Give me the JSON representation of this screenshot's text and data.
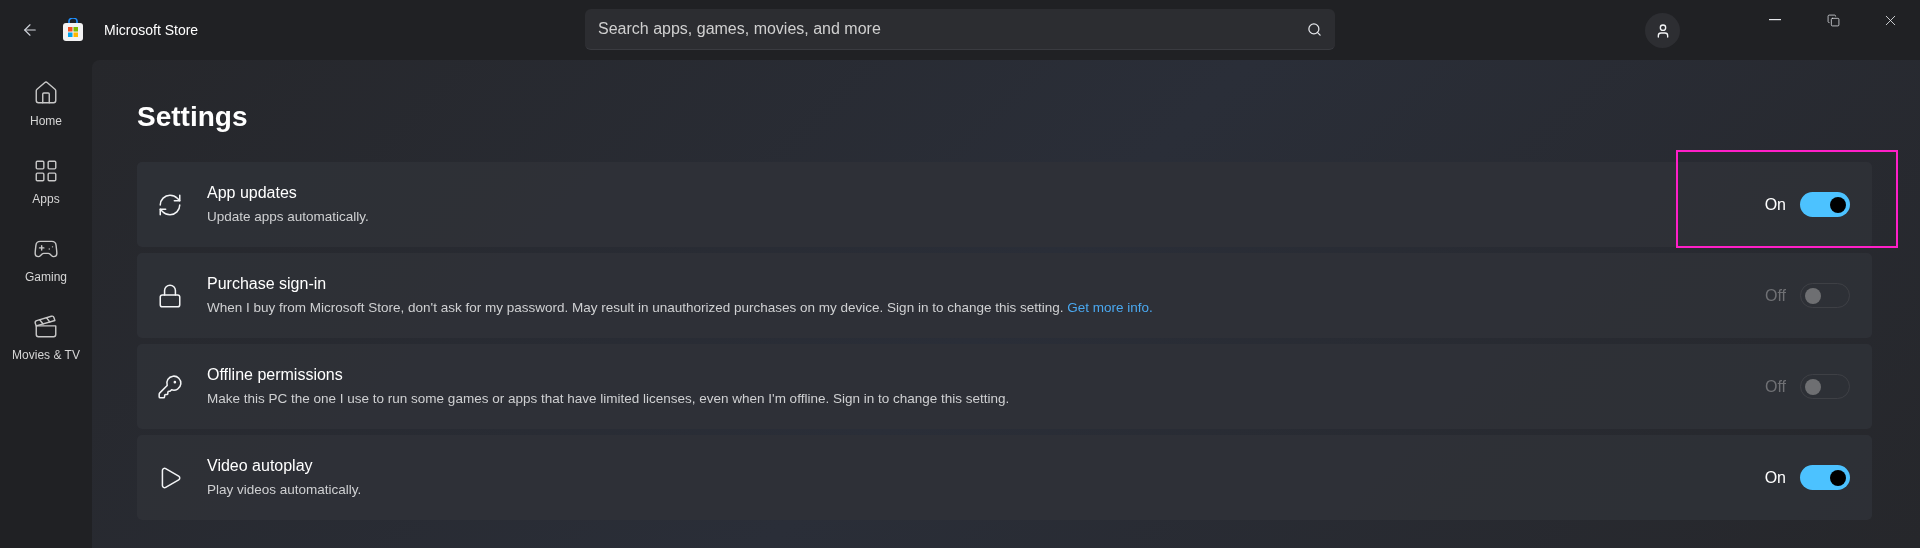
{
  "window": {
    "title": "Microsoft Store"
  },
  "search": {
    "placeholder": "Search apps, games, movies, and more"
  },
  "sidebar": {
    "items": [
      {
        "label": "Home"
      },
      {
        "label": "Apps"
      },
      {
        "label": "Gaming"
      },
      {
        "label": "Movies & TV"
      }
    ]
  },
  "page_title": "Settings",
  "settings": [
    {
      "title": "App updates",
      "description": "Update apps automatically.",
      "state_label": "On",
      "on": true,
      "disabled": false,
      "highlighted": true
    },
    {
      "title": "Purchase sign-in",
      "description": "When I buy from Microsoft Store, don't ask for my password. May result in unauthorized purchases on my device. Sign in to change this setting.",
      "link": "Get more info.",
      "state_label": "Off",
      "on": false,
      "disabled": true,
      "highlighted": false
    },
    {
      "title": "Offline permissions",
      "description": "Make this PC the one I use to run some games or apps that have limited licenses, even when I'm offline. Sign in to change this setting.",
      "state_label": "Off",
      "on": false,
      "disabled": true,
      "highlighted": false
    },
    {
      "title": "Video autoplay",
      "description": "Play videos automatically.",
      "state_label": "On",
      "on": true,
      "disabled": false,
      "highlighted": false
    }
  ]
}
